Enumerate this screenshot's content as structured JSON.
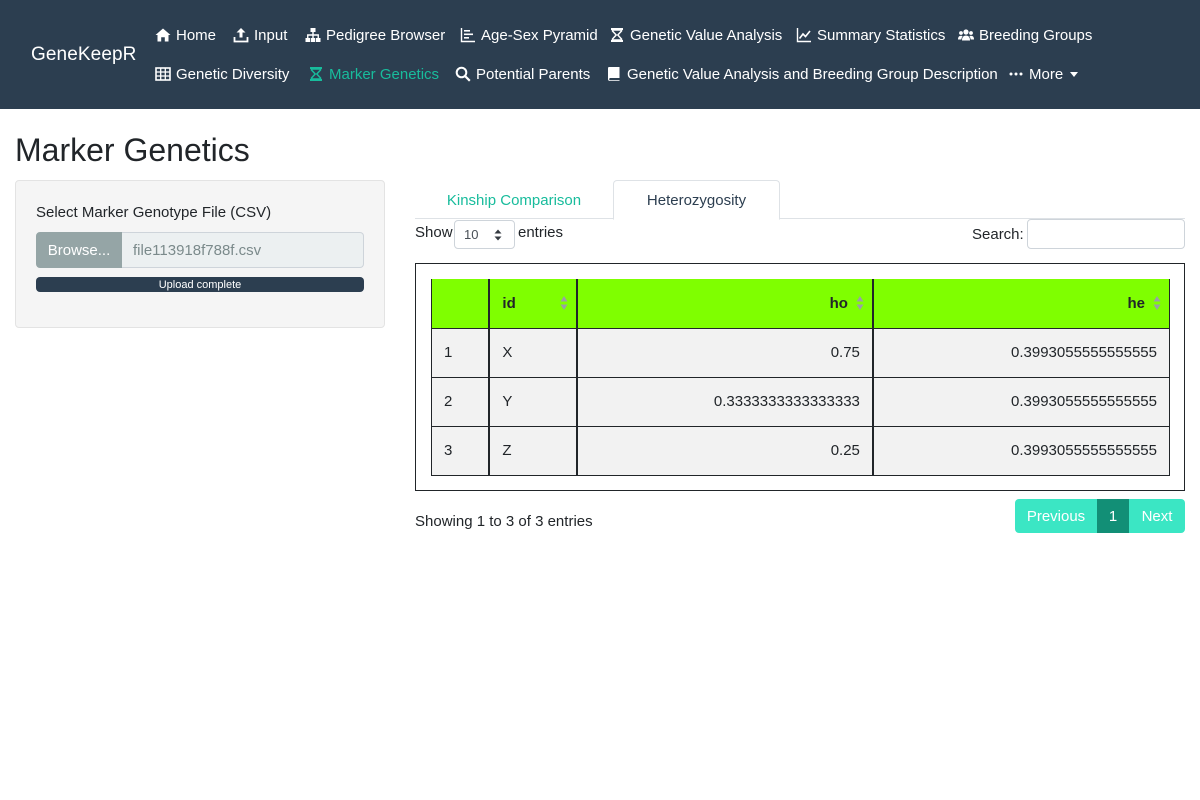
{
  "app": {
    "brand": "GeneKeepR"
  },
  "nav": {
    "row1": [
      {
        "label": "Home",
        "icon": "home-icon"
      },
      {
        "label": "Input",
        "icon": "upload-icon"
      },
      {
        "label": "Pedigree Browser",
        "icon": "sitemap-icon"
      },
      {
        "label": "Age-Sex Pyramid",
        "icon": "bar-chart-icon"
      },
      {
        "label": "Genetic Value Analysis",
        "icon": "hourglass-icon"
      },
      {
        "label": "Summary Statistics",
        "icon": "line-chart-icon"
      },
      {
        "label": "Breeding Groups",
        "icon": "users-icon"
      }
    ],
    "row2": [
      {
        "label": "Genetic Diversity",
        "icon": "table-icon"
      },
      {
        "label": "Marker Genetics",
        "icon": "hourglass-icon",
        "active": true
      },
      {
        "label": "Potential Parents",
        "icon": "search-icon"
      },
      {
        "label": "Genetic Value Analysis and Breeding Group Description",
        "icon": "book-icon"
      },
      {
        "label": "More",
        "icon": "ellipsis-icon"
      }
    ]
  },
  "page": {
    "title": "Marker Genetics"
  },
  "sidebar": {
    "file_label": "Select Marker Genotype File (CSV)",
    "browse_label": "Browse...",
    "file_name": "file113918f788f.csv",
    "progress_label": "Upload complete",
    "progress_fraction": 1.0
  },
  "tabs": [
    {
      "label": "Kinship Comparison",
      "active": false
    },
    {
      "label": "Heterozygosity",
      "active": true
    }
  ],
  "table_controls": {
    "show_label": "Show",
    "length_value": "10",
    "entries_label": "entries",
    "search_label": "Search:",
    "search_value": ""
  },
  "table": {
    "columns": [
      "",
      "id",
      "ho",
      "he"
    ],
    "rows": [
      [
        "1",
        "X",
        "0.75",
        "0.3993055555555555"
      ],
      [
        "2",
        "Y",
        "0.3333333333333333",
        "0.3993055555555555"
      ],
      [
        "3",
        "Z",
        "0.25",
        "0.3993055555555555"
      ]
    ],
    "header_color": "#7fff00"
  },
  "footer": {
    "info": "Showing 1 to 3 of 3 entries",
    "previous_label": "Previous",
    "current_page": "1",
    "next_label": "Next"
  },
  "colors": {
    "navbar": "#2c3e50",
    "accent": "#18bc9c"
  }
}
